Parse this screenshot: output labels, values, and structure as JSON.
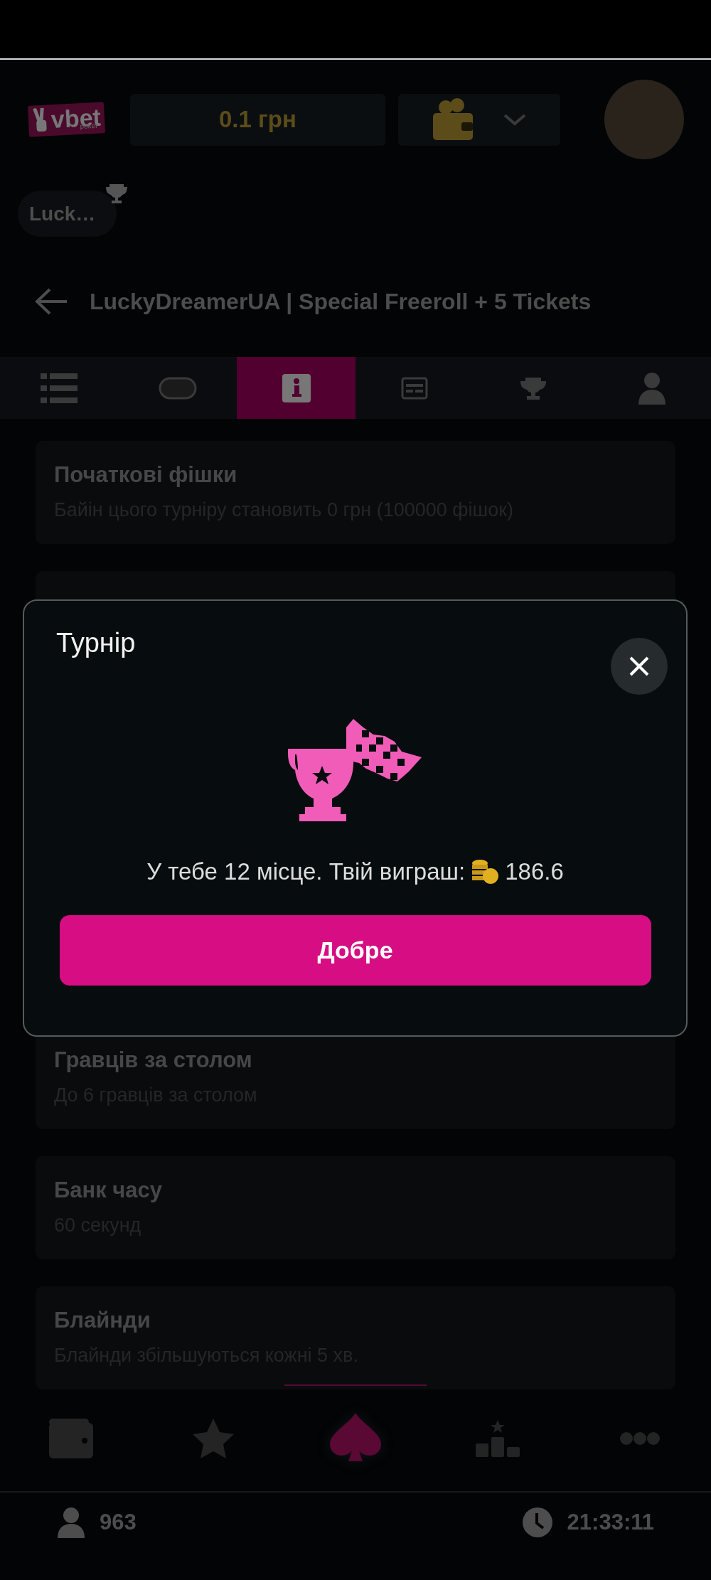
{
  "header": {
    "logo": {
      "name": "vbet",
      "sub": "poker"
    },
    "balance": "0.1 грн"
  },
  "chip": {
    "label": "Luck…"
  },
  "title": "LuckyDreamerUA | Special Freeroll + 5 Tickets",
  "tabs": [
    {
      "kind": "list",
      "selected": false
    },
    {
      "kind": "table",
      "selected": false
    },
    {
      "kind": "info",
      "selected": true
    },
    {
      "kind": "ticket",
      "selected": false
    },
    {
      "kind": "trophy",
      "selected": false
    },
    {
      "kind": "player",
      "selected": false
    }
  ],
  "cards": [
    {
      "kind": "info",
      "title": "Початкові фішки",
      "subtitle": "Байін цього турніру становить 0 грн (100000 фішок)"
    },
    {
      "kind": "hidden"
    },
    {
      "kind": "info",
      "title": "Гравців за столом",
      "subtitle": "До 6 гравців за столом"
    },
    {
      "kind": "info",
      "title": "Банк часу",
      "subtitle": "60 секунд"
    },
    {
      "kind": "info",
      "title": "Блайнди",
      "subtitle": "Блайнди збільшуються кожні 5 хв."
    }
  ],
  "nav": [
    {
      "kind": "wallet",
      "selected": false
    },
    {
      "kind": "star",
      "selected": false
    },
    {
      "kind": "spade",
      "selected": true
    },
    {
      "kind": "podium",
      "selected": false
    },
    {
      "kind": "more",
      "selected": false
    }
  ],
  "status_bar": {
    "players": "963",
    "time": "21:33:11"
  },
  "dialog": {
    "title": "Турнір",
    "message": "У тебе 12 місце. Твій виграш:",
    "amount": "186.6",
    "button": "Добре"
  }
}
